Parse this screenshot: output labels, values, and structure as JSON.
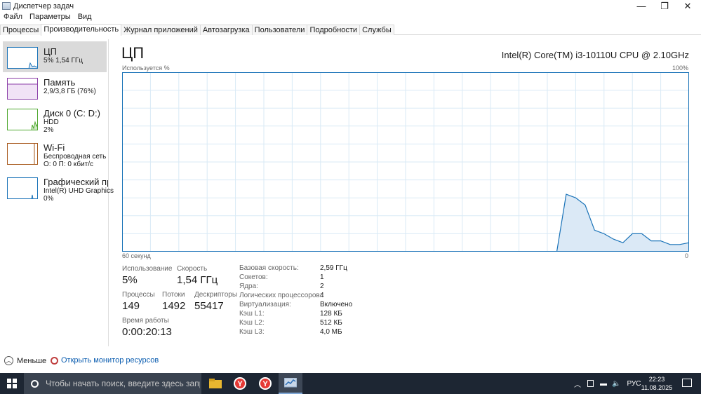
{
  "window": {
    "title": "Диспетчер задач",
    "controls": {
      "minimize": "—",
      "maximize": "❐",
      "close": "✕"
    }
  },
  "menu": [
    "Файл",
    "Параметры",
    "Вид"
  ],
  "tabs": [
    "Процессы",
    "Производительность",
    "Журнал приложений",
    "Автозагрузка",
    "Пользователи",
    "Подробности",
    "Службы"
  ],
  "active_tab": "Производительность",
  "sidebar": {
    "items": [
      {
        "name": "ЦП",
        "line1": "5% 1,54 ГГц",
        "line2": "",
        "color": "#1a73b8",
        "active": true
      },
      {
        "name": "Память",
        "line1": "2,9/3,8 ГБ (76%)",
        "line2": "",
        "color": "#8b3fa8",
        "active": false
      },
      {
        "name": "Диск 0 (C: D:)",
        "line1": "HDD",
        "line2": "2%",
        "color": "#4ea72e",
        "active": false
      },
      {
        "name": "Wi-Fi",
        "line1": "Беспроводная сеть",
        "line2": "О: 0 П: 0 кбит/с",
        "color": "#a7591c",
        "active": false
      },
      {
        "name": "Графический про",
        "line1": "Intel(R) UHD Graphics",
        "line2": "0%",
        "color": "#1a73b8",
        "active": false
      }
    ]
  },
  "main": {
    "title": "ЦП",
    "model": "Intel(R) Core(TM) i3-10110U CPU @ 2.10GHz",
    "axis_top_left": "Используется %",
    "axis_top_right": "100%",
    "axis_bottom_left": "60 секунд",
    "axis_bottom_right": "0"
  },
  "chart_data": {
    "type": "area",
    "ylim": [
      0,
      100
    ],
    "xlim": [
      60,
      0
    ],
    "grid": true,
    "color": "#1a73b8",
    "fill": "#dbe9f6",
    "values": [
      0,
      0,
      0,
      0,
      0,
      0,
      0,
      0,
      0,
      0,
      0,
      0,
      0,
      0,
      0,
      0,
      0,
      0,
      0,
      0,
      0,
      0,
      0,
      0,
      0,
      0,
      0,
      0,
      0,
      0,
      0,
      0,
      0,
      0,
      0,
      0,
      0,
      0,
      0,
      0,
      0,
      0,
      0,
      0,
      0,
      0,
      0,
      32,
      30,
      26,
      12,
      10,
      7,
      5,
      10,
      10,
      6,
      6,
      4,
      4,
      5
    ]
  },
  "stats": {
    "usage_label": "Использование",
    "usage_value": "5%",
    "speed_label": "Скорость",
    "speed_value": "1,54 ГГц",
    "processes_label": "Процессы",
    "processes_value": "149",
    "threads_label": "Потоки",
    "threads_value": "1492",
    "handles_label": "Дескрипторы",
    "handles_value": "55417",
    "uptime_label": "Время работы",
    "uptime_value": "0:00:20:13"
  },
  "specs": [
    {
      "label": "Базовая скорость:",
      "value": "2,59 ГГц"
    },
    {
      "label": "Сокетов:",
      "value": "1"
    },
    {
      "label": "Ядра:",
      "value": "2"
    },
    {
      "label": "Логических процессоров:",
      "value": "4"
    },
    {
      "label": "Виртуализация:",
      "value": "Включено"
    },
    {
      "label": "Кэш L1:",
      "value": "128 КБ"
    },
    {
      "label": "Кэш L2:",
      "value": "512 КБ"
    },
    {
      "label": "Кэш L3:",
      "value": "4,0 МБ"
    }
  ],
  "footer": {
    "less_label": "Меньше",
    "resmon_label": "Открыть монитор ресурсов"
  },
  "taskbar": {
    "search_placeholder": "Чтобы начать поиск, введите здесь запрос",
    "language": "РУС",
    "time": "22:23",
    "date": "11.08.2025"
  }
}
